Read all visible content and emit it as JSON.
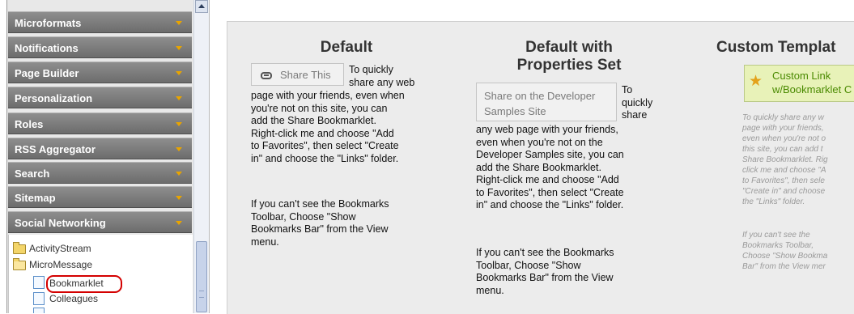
{
  "sidebar": {
    "sections": [
      {
        "label": "Microformats"
      },
      {
        "label": "Notifications"
      },
      {
        "label": "Page Builder"
      },
      {
        "label": "Personalization"
      },
      {
        "label": "Roles"
      },
      {
        "label": "RSS Aggregator"
      },
      {
        "label": "Search"
      },
      {
        "label": "Sitemap"
      },
      {
        "label": "Social Networking"
      }
    ],
    "tree": [
      {
        "label": "ActivityStream",
        "icon": "folder-icon"
      },
      {
        "label": "MicroMessage",
        "icon": "open-folder-icon"
      },
      {
        "label": "Bookmarklet",
        "icon": "document-icon"
      },
      {
        "label": "Colleagues",
        "icon": "document-icon"
      }
    ]
  },
  "columns": {
    "default": {
      "title": "Default",
      "button": "Share This",
      "text_beside_1": "To quickly",
      "text_beside_2": "share any web",
      "text_body": [
        "page with your friends, even when",
        "you're not on this site, you can",
        "add the Share Bookmarklet.",
        "Right-click me and choose \"Add",
        "to Favorites\", then select \"Create",
        "in\" and choose the \"Links\" folder."
      ],
      "text_body2": [
        "If you can't see the Bookmarks",
        "Toolbar, Choose \"Show",
        "Bookmarks Bar\" from the View",
        "menu."
      ]
    },
    "props": {
      "title_line1": "Default with",
      "title_line2": "Properties Set",
      "button_line1": "Share on the Developer",
      "button_line2": "Samples Site",
      "text_beside": [
        "To",
        "quickly",
        "share"
      ],
      "text_body": [
        "any web page with your friends,",
        "even when you're not on the",
        "Developer Samples site, you can",
        "add the Share Bookmarklet.",
        "Right-click me and choose \"Add",
        "to Favorites\", then select \"Create",
        "in\" and choose the \"Links\" folder."
      ],
      "text_body2": [
        "If you can't see the Bookmarks",
        "Toolbar, Choose \"Show",
        "Bookmarks Bar\" from the View",
        "menu."
      ]
    },
    "custom": {
      "title": "Custom Templat",
      "button_line1": "Custom Link",
      "button_line2": "w/Bookmarklet C",
      "text_body": [
        "To quickly share any w",
        "page with your friends,",
        "even when you're not o",
        "this site, you can add t",
        "Share Bookmarklet. Rig",
        "click me and choose \"A",
        "to Favorites\", then sele",
        "\"Create in\" and choose",
        "the \"Links\" folder."
      ],
      "text_body2": [
        "If you can't see the",
        "Bookmarks Toolbar,",
        "Choose \"Show Bookma",
        "Bar\" from the View mer"
      ]
    }
  },
  "colors": {
    "nav_header": "#7c7c7c",
    "chevron": "#e8a400",
    "highlight_circle": "#d40000",
    "custom_button_bg": "#e8f2b8"
  }
}
